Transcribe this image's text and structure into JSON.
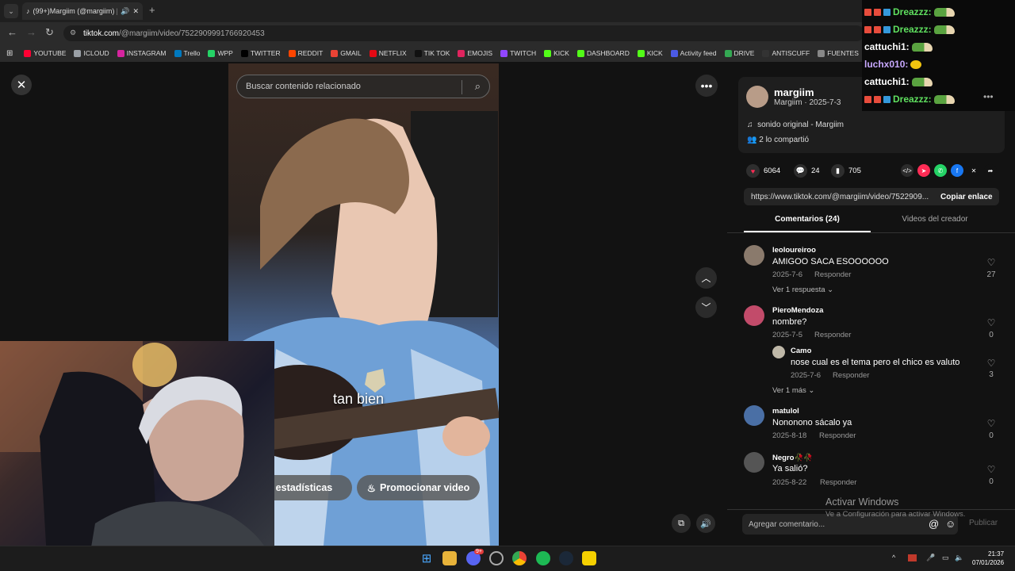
{
  "browser": {
    "tab_title": "(99+)Margiim (@margiim) |",
    "url_host": "tiktok.com",
    "url_path": "/@margiim/video/7522909991766920453",
    "bookmarks": [
      {
        "label": "YOUTUBE",
        "color": "#ff0033"
      },
      {
        "label": "ICLOUD",
        "color": "#9aa0a6"
      },
      {
        "label": "INSTAGRAM",
        "color": "#d6249f"
      },
      {
        "label": "Trello",
        "color": "#0079bf"
      },
      {
        "label": "WPP",
        "color": "#25d366"
      },
      {
        "label": "TWITTER",
        "color": "#000000"
      },
      {
        "label": "REDDIT",
        "color": "#ff4500"
      },
      {
        "label": "GMAIL",
        "color": "#ea4335"
      },
      {
        "label": "NETFLIX",
        "color": "#e50914"
      },
      {
        "label": "TIK TOK",
        "color": "#111111"
      },
      {
        "label": "EMOJIS",
        "color": "#e0245e"
      },
      {
        "label": "TWITCH",
        "color": "#9146ff"
      },
      {
        "label": "KICK",
        "color": "#53fc18"
      },
      {
        "label": "DASHBOARD",
        "color": "#53fc18"
      },
      {
        "label": "KICK",
        "color": "#53fc18"
      },
      {
        "label": "Activity feed",
        "color": "#4b5ae5"
      },
      {
        "label": "DRIVE",
        "color": "#34a853"
      },
      {
        "label": "ANTISCUFF",
        "color": "#333333"
      },
      {
        "label": "FUENTES",
        "color": "#888888"
      }
    ]
  },
  "video": {
    "search_placeholder": "Buscar contenido relacionado",
    "caption": "tan bien",
    "stats_button": "Ver estadísticas",
    "promote_button": "Promocionar video"
  },
  "author": {
    "name": "margiim",
    "sub": "Margiim · 2025-7-3",
    "music": "sonido original - Margiim",
    "shared": "2 lo compartió"
  },
  "stats": {
    "likes": "6064",
    "comments": "24",
    "saves": "705"
  },
  "share_colors": [
    "#2b2b2b",
    "#fe2c55",
    "#25d366",
    "#1877f2",
    "#000000",
    "#2b2b2b"
  ],
  "link": {
    "url": "https://www.tiktok.com/@margiim/video/7522909...",
    "copy": "Copiar enlace"
  },
  "tabs": {
    "comments": "Comentarios (24)",
    "creator": "Videos del creador"
  },
  "comments": [
    {
      "user": "leoloureiroo",
      "text": "AMIGOO SACA ESOOOOOO",
      "date": "2025-7-6",
      "reply": "Responder",
      "likes": "27",
      "more": "Ver 1 respuesta"
    },
    {
      "user": "PieroMendoza",
      "text": "nombre?",
      "date": "2025-7-5",
      "reply": "Responder",
      "likes": "0"
    },
    {
      "user": "Camo",
      "text": "nose cual es el tema pero el chico es valuto",
      "date": "2025-7-6",
      "reply": "Responder",
      "likes": "3",
      "more": "Ver 1 más"
    },
    {
      "user": "matulol",
      "text": "Nononono sácalo ya",
      "date": "2025-8-18",
      "reply": "Responder",
      "likes": "0"
    },
    {
      "user": "Negro🥀🥀",
      "text": "Ya salió?",
      "date": "2025-8-22",
      "reply": "Responder",
      "likes": "0"
    }
  ],
  "comment_input": {
    "placeholder": "Agregar comentario...",
    "publish": "Publicar"
  },
  "windows": {
    "activate_title": "Activar Windows",
    "activate_sub": "Ve a Configuración para activar Windows."
  },
  "chat": [
    {
      "user": "Dreazzz:",
      "color": "#5fe05f"
    },
    {
      "user": "Dreazzz:",
      "color": "#5fe05f"
    },
    {
      "user": "cattuchi1:",
      "color": "#ffffff"
    },
    {
      "user": "luchx010:",
      "color": "#c8a8ff"
    },
    {
      "user": "cattuchi1:",
      "color": "#ffffff"
    },
    {
      "user": "Dreazzz:",
      "color": "#5fe05f"
    }
  ],
  "taskbar": {
    "time": "21:37",
    "date": "07/01/2026",
    "discord_badge": "9+"
  }
}
